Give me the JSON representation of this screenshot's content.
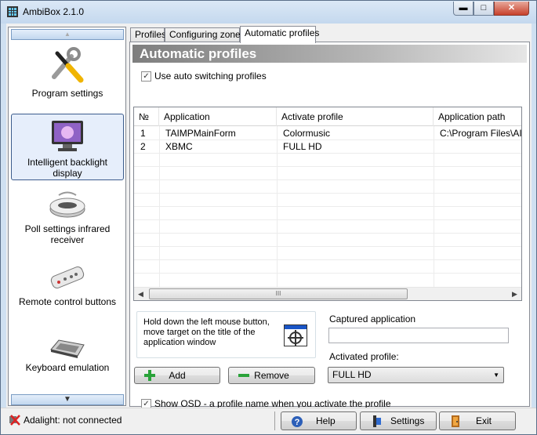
{
  "window": {
    "title": "AmbiBox 2.1.0",
    "min_glyph": "▬",
    "max_glyph": "□",
    "close_glyph": "✕"
  },
  "sidebar": {
    "up_glyph": "▲",
    "down_glyph": "▼",
    "items": [
      {
        "label": "Program settings",
        "icon": "tools-icon"
      },
      {
        "label": "Intelligent backlight display",
        "icon": "monitor-icon",
        "selected": true
      },
      {
        "label": "Poll settings infrared receiver",
        "icon": "ir-receiver-icon"
      },
      {
        "label": "Remote control buttons",
        "icon": "remote-control-icon"
      },
      {
        "label": "Keyboard emulation",
        "icon": "keyboard-icon"
      }
    ]
  },
  "tabs": [
    {
      "label": "Profiles"
    },
    {
      "label": "Configuring zones"
    },
    {
      "label": "Automatic profiles",
      "active": true
    }
  ],
  "panel": {
    "title": "Automatic profiles",
    "use_auto_switching": {
      "label": "Use auto switching profiles",
      "checked": true,
      "mark": "✓"
    },
    "table": {
      "columns": [
        "№",
        "Application",
        "Activate profile",
        "Application path"
      ],
      "rows": [
        [
          "1",
          "TAIMPMainForm",
          "Colormusic",
          "C:\\Program Files\\AIMP"
        ],
        [
          "2",
          "XBMC",
          "FULL HD",
          ""
        ]
      ],
      "scroll_left": "◀",
      "scroll_right": "▶",
      "thumb_grip": "III"
    },
    "hint": "Hold down the left mouse button, move target on the title of the application window",
    "captured_label": "Captured application",
    "captured_value": "",
    "activated_label": "Activated profile:",
    "activated_value": "FULL HD",
    "combo_arrow": "▼",
    "add_label": "Add",
    "remove_label": "Remove",
    "show_osd": {
      "label": "Show OSD - a profile name when you activate the profile",
      "checked": true,
      "mark": "✓"
    }
  },
  "statusbar": {
    "status_text": "Adalight: not connected",
    "help_label": "Help",
    "settings_label": "Settings",
    "exit_label": "Exit"
  }
}
